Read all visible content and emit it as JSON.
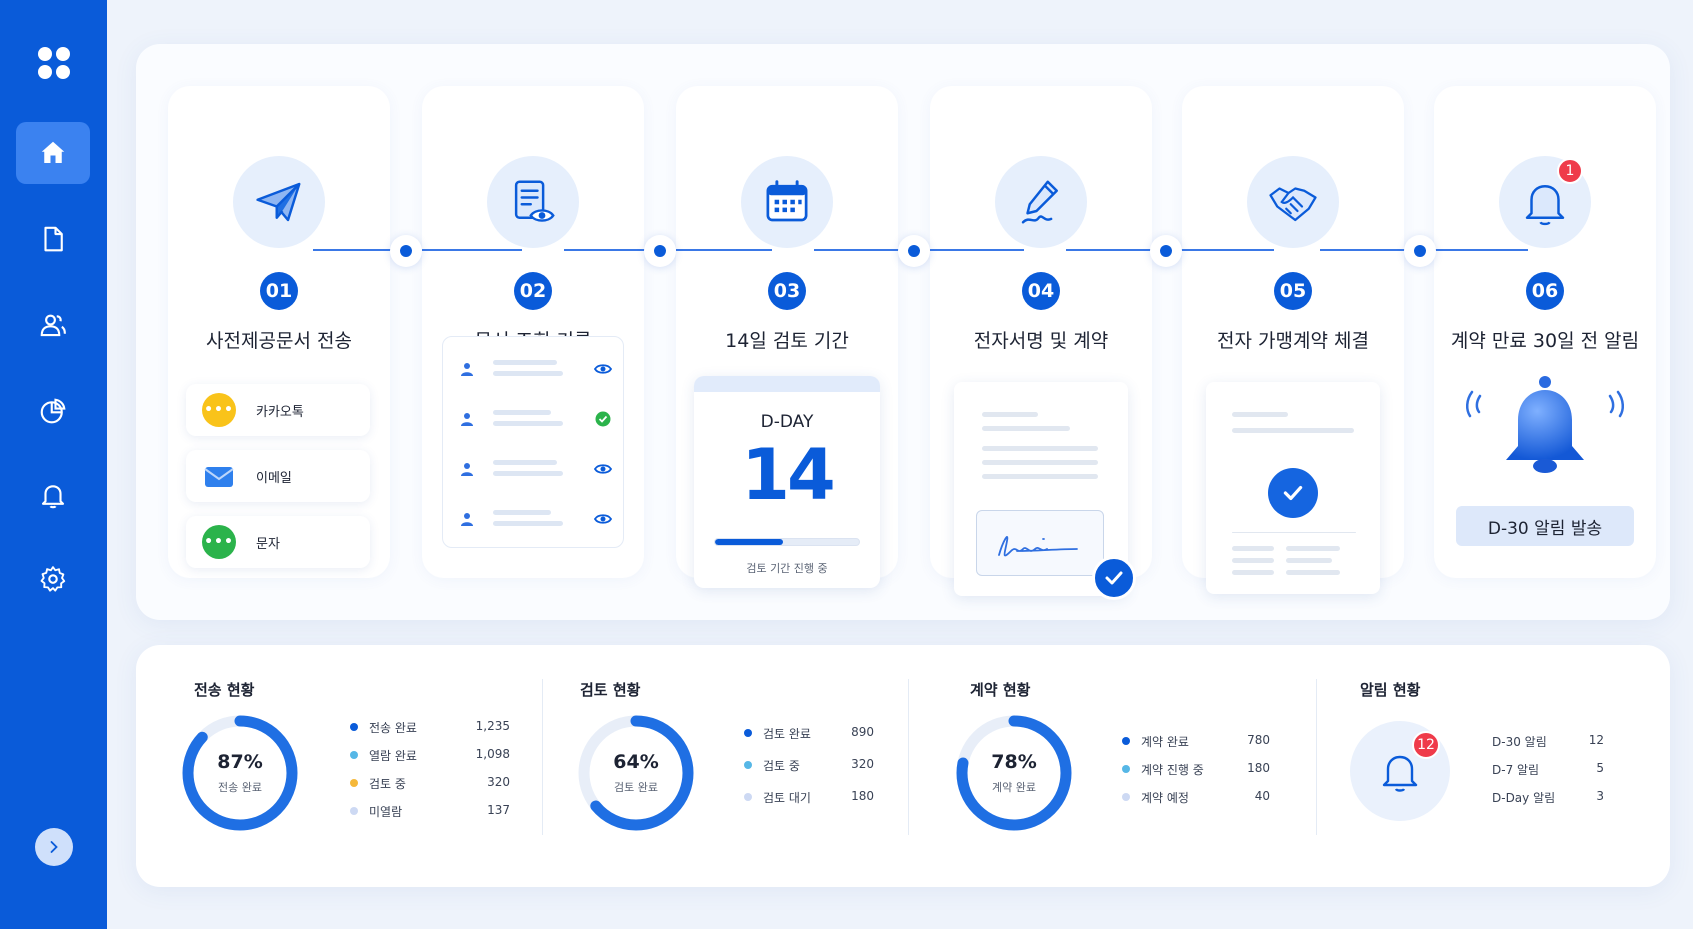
{
  "sidebar": {
    "items": [
      {
        "name": "home",
        "icon": "home-icon",
        "active": true
      },
      {
        "name": "documents",
        "icon": "document-icon"
      },
      {
        "name": "users",
        "icon": "users-icon"
      },
      {
        "name": "reports",
        "icon": "pie-chart-icon"
      },
      {
        "name": "alerts",
        "icon": "bell-icon"
      },
      {
        "name": "settings",
        "icon": "gear-icon"
      }
    ],
    "expand_icon": "chevron-right-icon"
  },
  "steps": [
    {
      "num": "01",
      "title": "사전제공문서 전송",
      "icon": "paper-plane-icon",
      "channels": [
        {
          "label": "카카오톡",
          "icon": "kakao-chat-icon",
          "color": "#f9c31a"
        },
        {
          "label": "이메일",
          "icon": "mail-icon",
          "color": "#2f80ed"
        },
        {
          "label": "문자",
          "icon": "sms-icon",
          "color": "#2bb34b"
        }
      ]
    },
    {
      "num": "02",
      "title": "문서 조회 기록",
      "icon": "document-view-icon",
      "rows": [
        {
          "status": "viewed",
          "icon": "eye-icon"
        },
        {
          "status": "confirmed",
          "icon": "check-circle-icon"
        },
        {
          "status": "viewed",
          "icon": "eye-icon"
        },
        {
          "status": "viewed",
          "icon": "eye-icon"
        }
      ]
    },
    {
      "num": "03",
      "title": "14일 검토 기간",
      "icon": "calendar-icon",
      "dday_label": "D-DAY",
      "dday_value": "14",
      "progress": 0.47,
      "progress_text": "검토 기간 진행 중"
    },
    {
      "num": "04",
      "title": "전자서명 및 계약",
      "icon": "pen-sign-icon"
    },
    {
      "num": "05",
      "title": "전자 가맹계약 체결",
      "icon": "handshake-icon"
    },
    {
      "num": "06",
      "title": "계약 만료 30일 전 알림",
      "icon": "bell-icon",
      "badge": "1",
      "button": "D-30 알림 발송"
    }
  ],
  "stats": {
    "transfer": {
      "title": "전송 현황",
      "percent": "87%",
      "percent_value": 87,
      "center_label": "전송 완료",
      "items": [
        {
          "label": "전송 완료",
          "value": "1,235",
          "color": "#0a5bd9"
        },
        {
          "label": "열람 완료",
          "value": "1,098",
          "color": "#56b7e6"
        },
        {
          "label": "검토 중",
          "value": "320",
          "color": "#f5b83a"
        },
        {
          "label": "미열람",
          "value": "137",
          "color": "#cdd9f3"
        }
      ]
    },
    "review": {
      "title": "검토 현황",
      "percent": "64%",
      "percent_value": 64,
      "center_label": "검토 완료",
      "items": [
        {
          "label": "검토 완료",
          "value": "890",
          "color": "#0a5bd9"
        },
        {
          "label": "검토 중",
          "value": "320",
          "color": "#56b7e6"
        },
        {
          "label": "검토 대기",
          "value": "180",
          "color": "#cdd9f3"
        }
      ]
    },
    "contract": {
      "title": "계약 현황",
      "percent": "78%",
      "percent_value": 78,
      "center_label": "계약 완료",
      "items": [
        {
          "label": "계약 완료",
          "value": "780",
          "color": "#0a5bd9"
        },
        {
          "label": "계약 진행 중",
          "value": "180",
          "color": "#56b7e6"
        },
        {
          "label": "계약 예정",
          "value": "40",
          "color": "#cdd9f3"
        }
      ]
    },
    "alarm": {
      "title": "알림 현황",
      "badge": "12",
      "items": [
        {
          "label": "D-30 알림",
          "value": "12"
        },
        {
          "label": "D-7 알림",
          "value": "5"
        },
        {
          "label": "D-Day 알림",
          "value": "3"
        }
      ]
    }
  },
  "colors": {
    "primary": "#0a5bd9",
    "sidebar": "#0a5bd9",
    "badge": "#ef3b4a"
  }
}
